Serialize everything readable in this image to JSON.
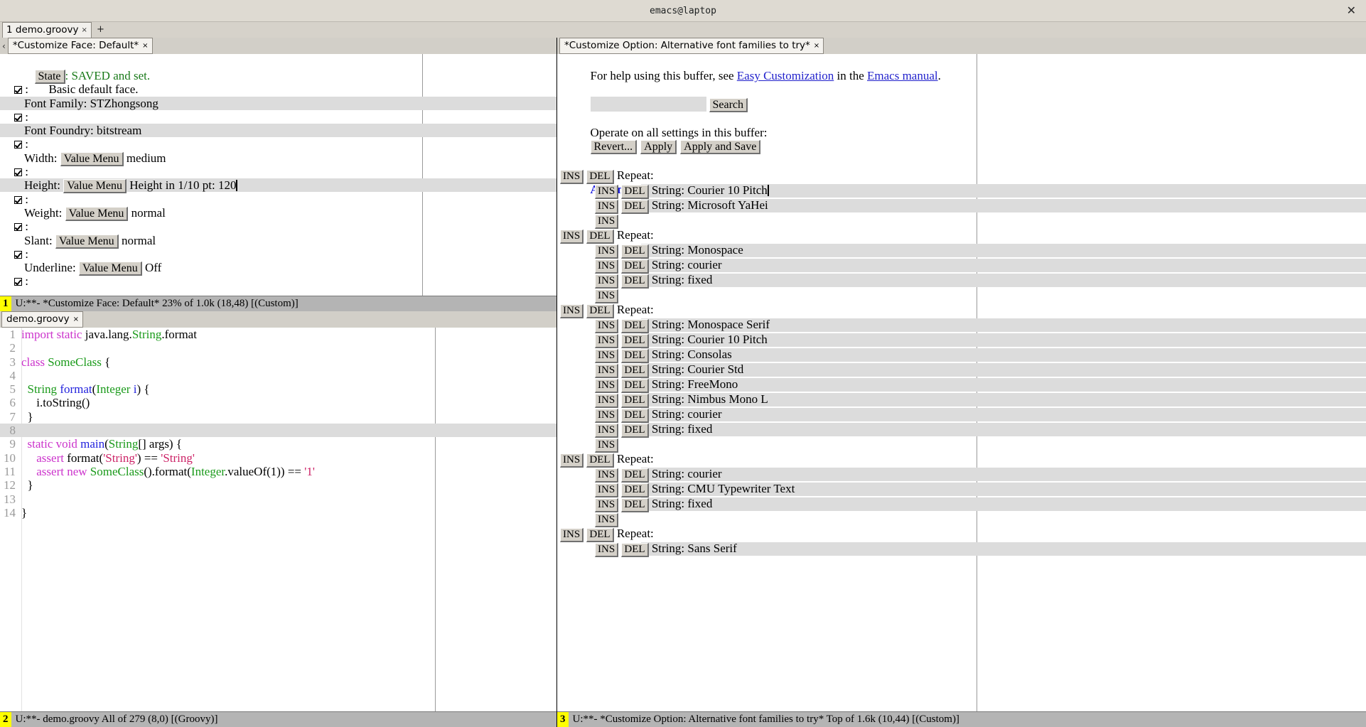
{
  "window": {
    "title": "emacs@laptop",
    "close_label": "✕"
  },
  "frame_tabs": {
    "tabs": [
      {
        "label": "1 demo.groovy",
        "close": "×"
      }
    ],
    "new_tab_label": "+"
  },
  "left_window": {
    "tabline": {
      "scroll_left": "‹",
      "tab_label": "*Customize Face: Default*",
      "tab_close": "×"
    },
    "state_button": "State",
    "state_text": ": SAVED and set.",
    "description": "Basic default face.",
    "attributes": [
      {
        "checkbox_suffix": ":",
        "label": "Font Family:",
        "widget": "text",
        "value": "STZhongsong",
        "highlight": true
      },
      {
        "checkbox_suffix": ":",
        "label": "Font Foundry:",
        "widget": "text",
        "value": "bitstream",
        "highlight": true
      },
      {
        "checkbox_suffix": ":",
        "label": "Width:",
        "widget": "menu",
        "menu_label": "Value Menu",
        "value": "medium",
        "highlight": false
      },
      {
        "checkbox_suffix": ":",
        "label": "Height:",
        "widget": "menu",
        "menu_label": "Value Menu",
        "value": "Height in 1/10 pt:",
        "field_value": "120",
        "highlight": true,
        "cursor": true
      },
      {
        "checkbox_suffix": ":",
        "label": "Weight:",
        "widget": "menu",
        "menu_label": "Value Menu",
        "value": "normal",
        "highlight": false
      },
      {
        "checkbox_suffix": ":",
        "label": "Slant:",
        "widget": "menu",
        "menu_label": "Value Menu",
        "value": "normal",
        "highlight": false
      },
      {
        "checkbox_suffix": ":",
        "label": "Underline:",
        "widget": "menu",
        "menu_label": "Value Menu",
        "value": "Off",
        "highlight": false
      }
    ],
    "modeline": {
      "window_number": "1",
      "text": "U:**-  *Customize Face: Default*   23% of 1.0k (18,48)    [(Custom)]"
    }
  },
  "code_window": {
    "tabline": {
      "tab_label": "demo.groovy",
      "tab_close": "×"
    },
    "lines": [
      {
        "n": "1",
        "tokens": [
          {
            "t": "import static ",
            "c": "k-keyword"
          },
          {
            "t": "java.lang.",
            "c": "k-plain"
          },
          {
            "t": "String",
            "c": "k-type"
          },
          {
            "t": ".format",
            "c": "k-plain"
          }
        ]
      },
      {
        "n": "2",
        "tokens": []
      },
      {
        "n": "3",
        "tokens": [
          {
            "t": "class ",
            "c": "k-keyword"
          },
          {
            "t": "SomeClass",
            "c": "k-type"
          },
          {
            "t": " {",
            "c": "k-plain"
          }
        ]
      },
      {
        "n": "4",
        "tokens": []
      },
      {
        "n": "5",
        "tokens": [
          {
            "t": "  ",
            "c": "k-plain"
          },
          {
            "t": "String ",
            "c": "k-type"
          },
          {
            "t": "format",
            "c": "k-fn"
          },
          {
            "t": "(",
            "c": "k-plain"
          },
          {
            "t": "Integer",
            "c": "k-type"
          },
          {
            "t": " ",
            "c": "k-plain"
          },
          {
            "t": "i",
            "c": "k-fn"
          },
          {
            "t": ") {",
            "c": "k-plain"
          }
        ]
      },
      {
        "n": "6",
        "tokens": [
          {
            "t": "     i.toString()",
            "c": "k-plain"
          }
        ]
      },
      {
        "n": "7",
        "tokens": [
          {
            "t": "  }",
            "c": "k-plain"
          }
        ]
      },
      {
        "n": "8",
        "tokens": [],
        "highlight": true
      },
      {
        "n": "9",
        "tokens": [
          {
            "t": "  ",
            "c": "k-plain"
          },
          {
            "t": "static void ",
            "c": "k-keyword"
          },
          {
            "t": "main",
            "c": "k-fn"
          },
          {
            "t": "(",
            "c": "k-plain"
          },
          {
            "t": "String",
            "c": "k-type"
          },
          {
            "t": "[] args) {",
            "c": "k-plain"
          }
        ]
      },
      {
        "n": "10",
        "tokens": [
          {
            "t": "     ",
            "c": "k-plain"
          },
          {
            "t": "assert ",
            "c": "k-keyword"
          },
          {
            "t": "format(",
            "c": "k-plain"
          },
          {
            "t": "'String'",
            "c": "k-str"
          },
          {
            "t": ") == ",
            "c": "k-plain"
          },
          {
            "t": "'String'",
            "c": "k-str"
          }
        ]
      },
      {
        "n": "11",
        "tokens": [
          {
            "t": "     ",
            "c": "k-plain"
          },
          {
            "t": "assert new ",
            "c": "k-keyword"
          },
          {
            "t": "SomeClass",
            "c": "k-type"
          },
          {
            "t": "().format(",
            "c": "k-plain"
          },
          {
            "t": "Integer",
            "c": "k-type"
          },
          {
            "t": ".valueOf(1)) == ",
            "c": "k-plain"
          },
          {
            "t": "'1'",
            "c": "k-str"
          }
        ]
      },
      {
        "n": "12",
        "tokens": [
          {
            "t": "  }",
            "c": "k-plain"
          }
        ]
      },
      {
        "n": "13",
        "tokens": []
      },
      {
        "n": "14",
        "tokens": [
          {
            "t": "}",
            "c": "k-plain"
          }
        ]
      }
    ],
    "modeline": {
      "window_number": "2",
      "text": "U:**-  demo.groovy    All of 279  (8,0)     [(Groovy)]"
    }
  },
  "right_window": {
    "tabline": {
      "tab_label": "*Customize Option: Alternative font families to try*",
      "tab_close": "×"
    },
    "help": {
      "prefix": "For help using this buffer, see ",
      "link1": "Easy Customization",
      "middle": " in the ",
      "link2": "Emacs manual",
      "suffix": "."
    },
    "search": {
      "value": "",
      "placeholder": "",
      "button_label": "Search"
    },
    "operate_label": "Operate on all settings in this buffer:",
    "buttons": [
      {
        "label": "Revert..."
      },
      {
        "label": "Apply"
      },
      {
        "label": "Apply and Save"
      }
    ],
    "group": {
      "toggle": "▽",
      "title": "Alternative font families to try",
      "colon": ":"
    },
    "ins_label": "INS",
    "del_label": "DEL",
    "repeat_label": "Repeat:",
    "string_label": "String:",
    "repeat_groups": [
      {
        "strings": [
          "Courier 10 Pitch",
          "Microsoft YaHei"
        ],
        "cursor_on": 0
      },
      {
        "strings": [
          "Monospace",
          "courier",
          "fixed"
        ]
      },
      {
        "strings": [
          "Monospace Serif",
          "Courier 10 Pitch",
          "Consolas",
          "Courier Std",
          "FreeMono",
          "Nimbus Mono L",
          "courier",
          "fixed"
        ]
      },
      {
        "strings": [
          "courier",
          "CMU Typewriter Text",
          "fixed"
        ]
      },
      {
        "strings": [
          "Sans Serif"
        ],
        "partial": true
      }
    ],
    "modeline": {
      "window_number": "3",
      "text": "U:**-  *Customize Option: Alternative font families to try*   Top of 1.6k (10,44)    [(Custom)]"
    }
  }
}
